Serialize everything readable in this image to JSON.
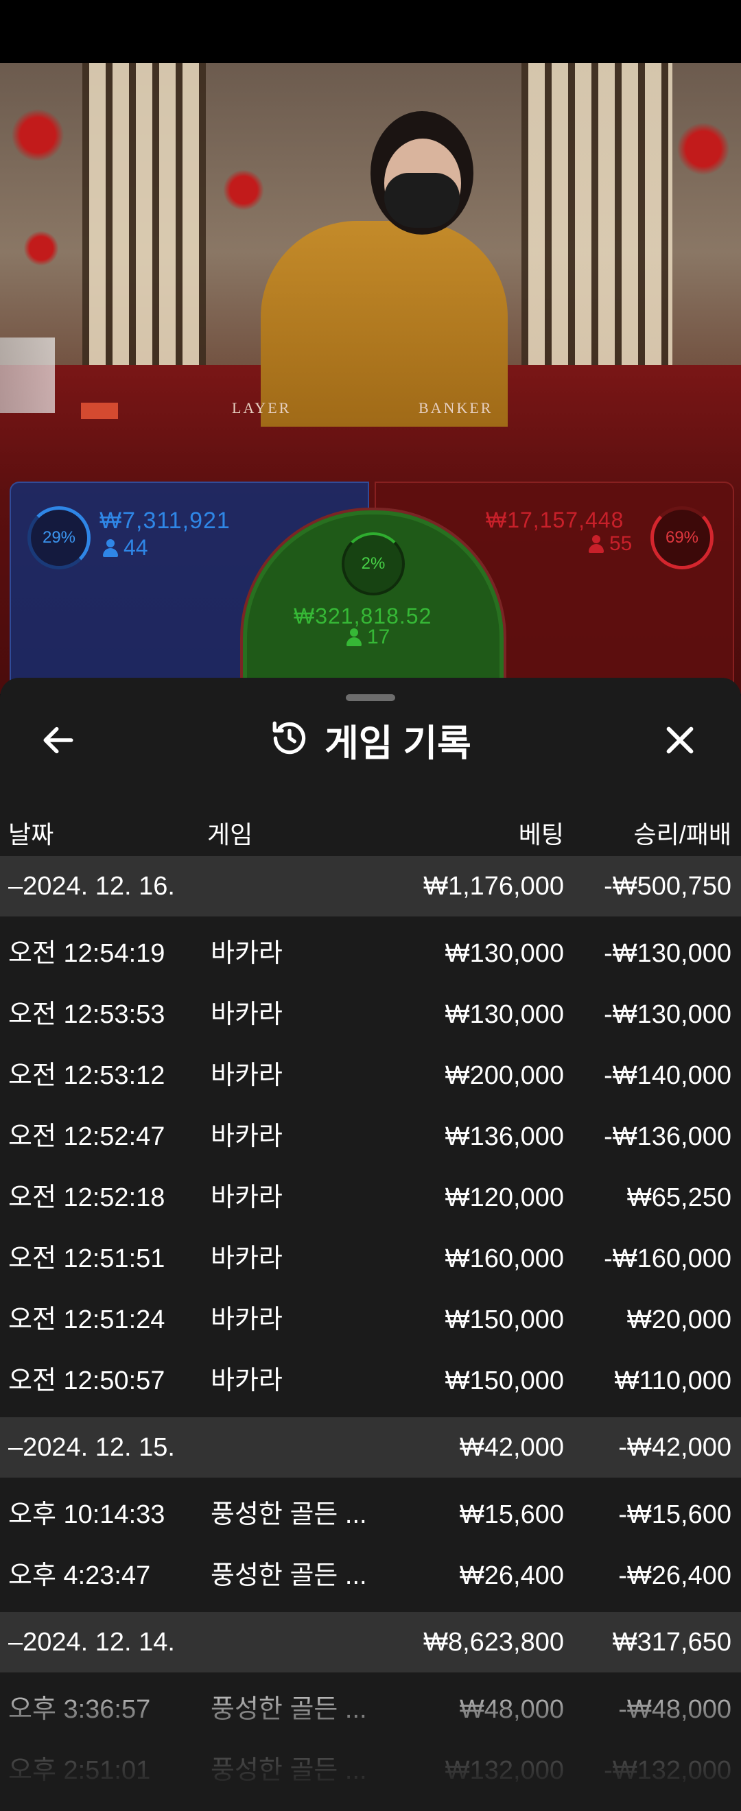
{
  "live_table": {
    "player": {
      "percent": "29%",
      "amount": "₩7,311,921",
      "players": "44"
    },
    "tie": {
      "percent": "2%",
      "amount": "₩321,818.52",
      "players": "17"
    },
    "banker": {
      "percent": "69%",
      "amount": "₩17,157,448",
      "players": "55"
    },
    "felt_player_text": "LAYER",
    "felt_banker_text": "BANKER",
    "colors": {
      "player": "#2f86e6",
      "tie": "#46d046",
      "banker": "#d4262e"
    }
  },
  "history": {
    "title": "게임 기록",
    "title_icon": "history-icon",
    "back_icon": "arrow-left-icon",
    "close_icon": "close-icon",
    "columns": {
      "date": "날짜",
      "game": "게임",
      "bet": "베팅",
      "result": "승리/패배"
    },
    "rows": [
      {
        "type": "group",
        "date": "–2024. 12. 16.",
        "game": "",
        "bet": "₩1,176,000",
        "result": "-₩500,750"
      },
      {
        "type": "item",
        "date": "오전 12:54:19",
        "game": "바카라",
        "bet": "₩130,000",
        "result": "-₩130,000"
      },
      {
        "type": "item",
        "date": "오전 12:53:53",
        "game": "바카라",
        "bet": "₩130,000",
        "result": "-₩130,000"
      },
      {
        "type": "item",
        "date": "오전 12:53:12",
        "game": "바카라",
        "bet": "₩200,000",
        "result": "-₩140,000"
      },
      {
        "type": "item",
        "date": "오전 12:52:47",
        "game": "바카라",
        "bet": "₩136,000",
        "result": "-₩136,000"
      },
      {
        "type": "item",
        "date": "오전 12:52:18",
        "game": "바카라",
        "bet": "₩120,000",
        "result": "₩65,250"
      },
      {
        "type": "item",
        "date": "오전 12:51:51",
        "game": "바카라",
        "bet": "₩160,000",
        "result": "-₩160,000"
      },
      {
        "type": "item",
        "date": "오전 12:51:24",
        "game": "바카라",
        "bet": "₩150,000",
        "result": "₩20,000"
      },
      {
        "type": "item",
        "date": "오전 12:50:57",
        "game": "바카라",
        "bet": "₩150,000",
        "result": "₩110,000"
      },
      {
        "type": "group",
        "date": "–2024. 12. 15.",
        "game": "",
        "bet": "₩42,000",
        "result": "-₩42,000"
      },
      {
        "type": "item",
        "date": "오후 10:14:33",
        "game": "풍성한 골든 ...",
        "bet": "₩15,600",
        "result": "-₩15,600"
      },
      {
        "type": "item",
        "date": "오후 4:23:47",
        "game": "풍성한 골든 ...",
        "bet": "₩26,400",
        "result": "-₩26,400"
      },
      {
        "type": "group",
        "date": "–2024. 12. 14.",
        "game": "",
        "bet": "₩8,623,800",
        "result": "₩317,650"
      },
      {
        "type": "item",
        "date": "오후 3:36:57",
        "game": "풍성한 골든 ...",
        "bet": "₩48,000",
        "result": "-₩48,000"
      },
      {
        "type": "item",
        "date": "오후 2:51:01",
        "game": "풍성한 골든 ...",
        "bet": "₩132,000",
        "result": "-₩132,000"
      }
    ]
  }
}
